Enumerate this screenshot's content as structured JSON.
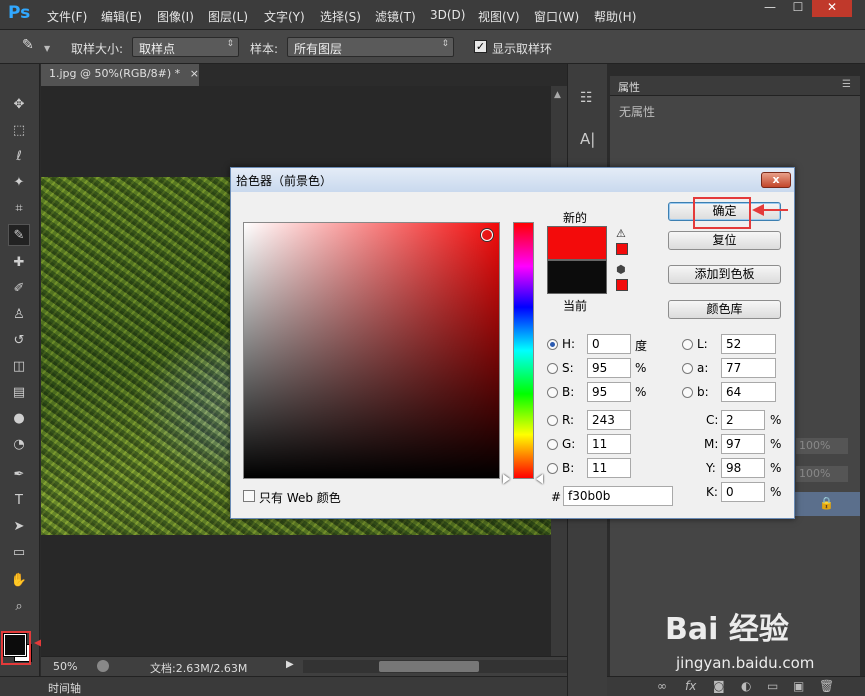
{
  "app": {
    "logo": "Ps"
  },
  "menu": [
    "文件(F)",
    "编辑(E)",
    "图像(I)",
    "图层(L)",
    "文字(Y)",
    "选择(S)",
    "滤镜(T)",
    "3D(D)",
    "视图(V)",
    "窗口(W)",
    "帮助(H)"
  ],
  "window_controls": {
    "minimize": "—",
    "maximize": "☐",
    "close": "✕"
  },
  "options_bar": {
    "sample_size_label": "取样大小:",
    "sample_size_value": "取样点",
    "sample_label": "样本:",
    "sample_value": "所有图层",
    "show_ring_label": "显示取样环",
    "show_ring_checked": true
  },
  "document": {
    "tab_title": "1.jpg @ 50%(RGB/8#) *",
    "tab_close": "×"
  },
  "status": {
    "zoom": "50%",
    "doc_info": "文档:2.63M/2.63M"
  },
  "timeline": {
    "label": "时间轴"
  },
  "properties": {
    "title": "属性",
    "empty_text": "无属性"
  },
  "layers": {
    "opacity_a": "100%",
    "opacity_b": "100%"
  },
  "dialog": {
    "title": "拾色器（前景色）",
    "close_glyph": "x",
    "new_label": "新的",
    "current_label": "当前",
    "new_color": "#f30b0b",
    "current_color": "#0c0c0c",
    "buttons": {
      "ok": "确定",
      "reset": "复位",
      "add_swatch": "添加到色板",
      "color_library": "颜色库"
    },
    "web_only_label": "只有 Web 颜色",
    "hsb": {
      "H": "0",
      "S": "95",
      "B": "95",
      "H_unit": "度",
      "S_unit": "%",
      "B_unit": "%"
    },
    "rgb": {
      "R": "243",
      "G": "11",
      "B": "11"
    },
    "lab": {
      "L": "52",
      "a": "77",
      "b": "64"
    },
    "cmyk": {
      "C": "2",
      "M": "97",
      "Y": "98",
      "K": "0",
      "unit": "%"
    },
    "hex_label": "#",
    "hex": "f30b0b",
    "labels": {
      "H": "H:",
      "S": "S:",
      "B": "B:",
      "R": "R:",
      "G": "G:",
      "Bb": "B:",
      "L": "L:",
      "a": "a:",
      "b": "b:",
      "C": "C:",
      "M": "M:",
      "Y": "Y:",
      "K": "K:"
    }
  },
  "watermark": {
    "brand": "Bai 经验",
    "url": "jingyan.baidu.com"
  },
  "colors": {
    "highlight": "#e43a3a",
    "ps_blue": "#31a8ff"
  }
}
